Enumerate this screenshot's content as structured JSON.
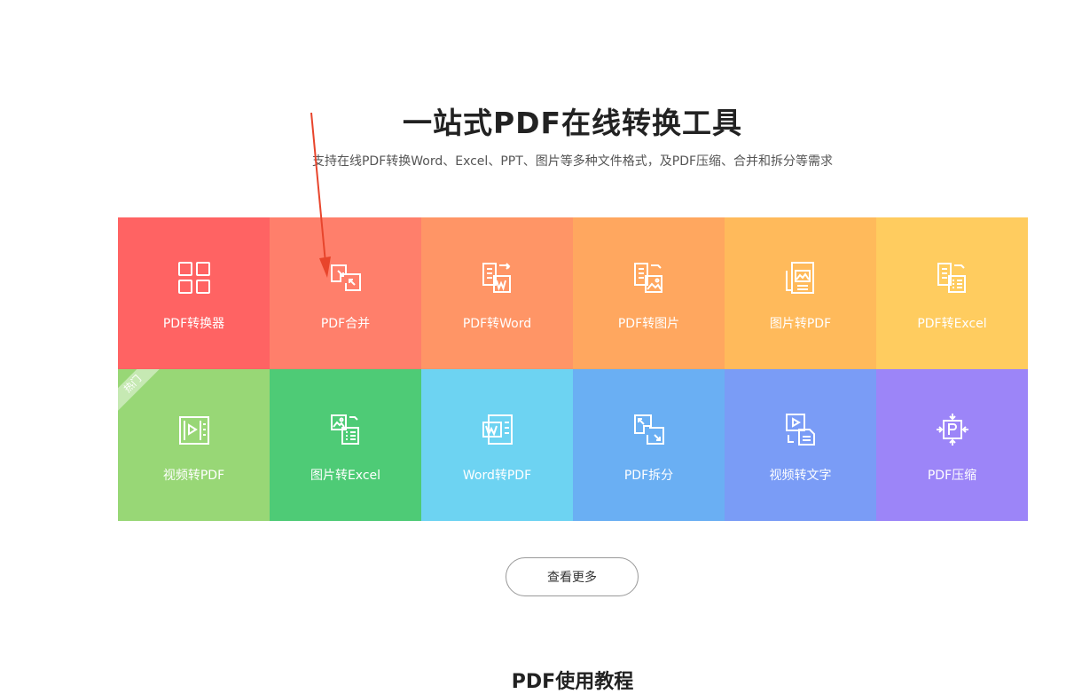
{
  "hero": {
    "title": "一站式PDF在线转换工具",
    "subtitle": "支持在线PDF转换Word、Excel、PPT、图片等多种文件格式，及PDF压缩、合并和拆分等需求"
  },
  "tools": [
    {
      "label": "PDF转换器",
      "icon": "grid-icon",
      "color": "#ff6363"
    },
    {
      "label": "PDF合并",
      "icon": "merge-icon",
      "color": "#ff7f6b"
    },
    {
      "label": "PDF转Word",
      "icon": "pdf-to-word-icon",
      "color": "#ff9566"
    },
    {
      "label": "PDF转图片",
      "icon": "pdf-to-image-icon",
      "color": "#ffa75f"
    },
    {
      "label": "图片转PDF",
      "icon": "image-to-pdf-icon",
      "color": "#ffba5b"
    },
    {
      "label": "PDF转Excel",
      "icon": "pdf-to-excel-icon",
      "color": "#ffcc5f"
    },
    {
      "label": "视频转PDF",
      "icon": "video-to-pdf-icon",
      "color": "#98d776",
      "badge": "热门"
    },
    {
      "label": "图片转Excel",
      "icon": "image-to-excel-icon",
      "color": "#4ecb76"
    },
    {
      "label": "Word转PDF",
      "icon": "word-to-pdf-icon",
      "color": "#6dd3f2"
    },
    {
      "label": "PDF拆分",
      "icon": "split-icon",
      "color": "#6aaff3"
    },
    {
      "label": "视频转文字",
      "icon": "video-to-text-icon",
      "color": "#7a9cf6"
    },
    {
      "label": "PDF压缩",
      "icon": "compress-icon",
      "color": "#9c85f8"
    }
  ],
  "more_button": {
    "label": "查看更多"
  },
  "tutorial": {
    "title": "PDF使用教程"
  },
  "annotation": {
    "color": "#e8452c"
  }
}
